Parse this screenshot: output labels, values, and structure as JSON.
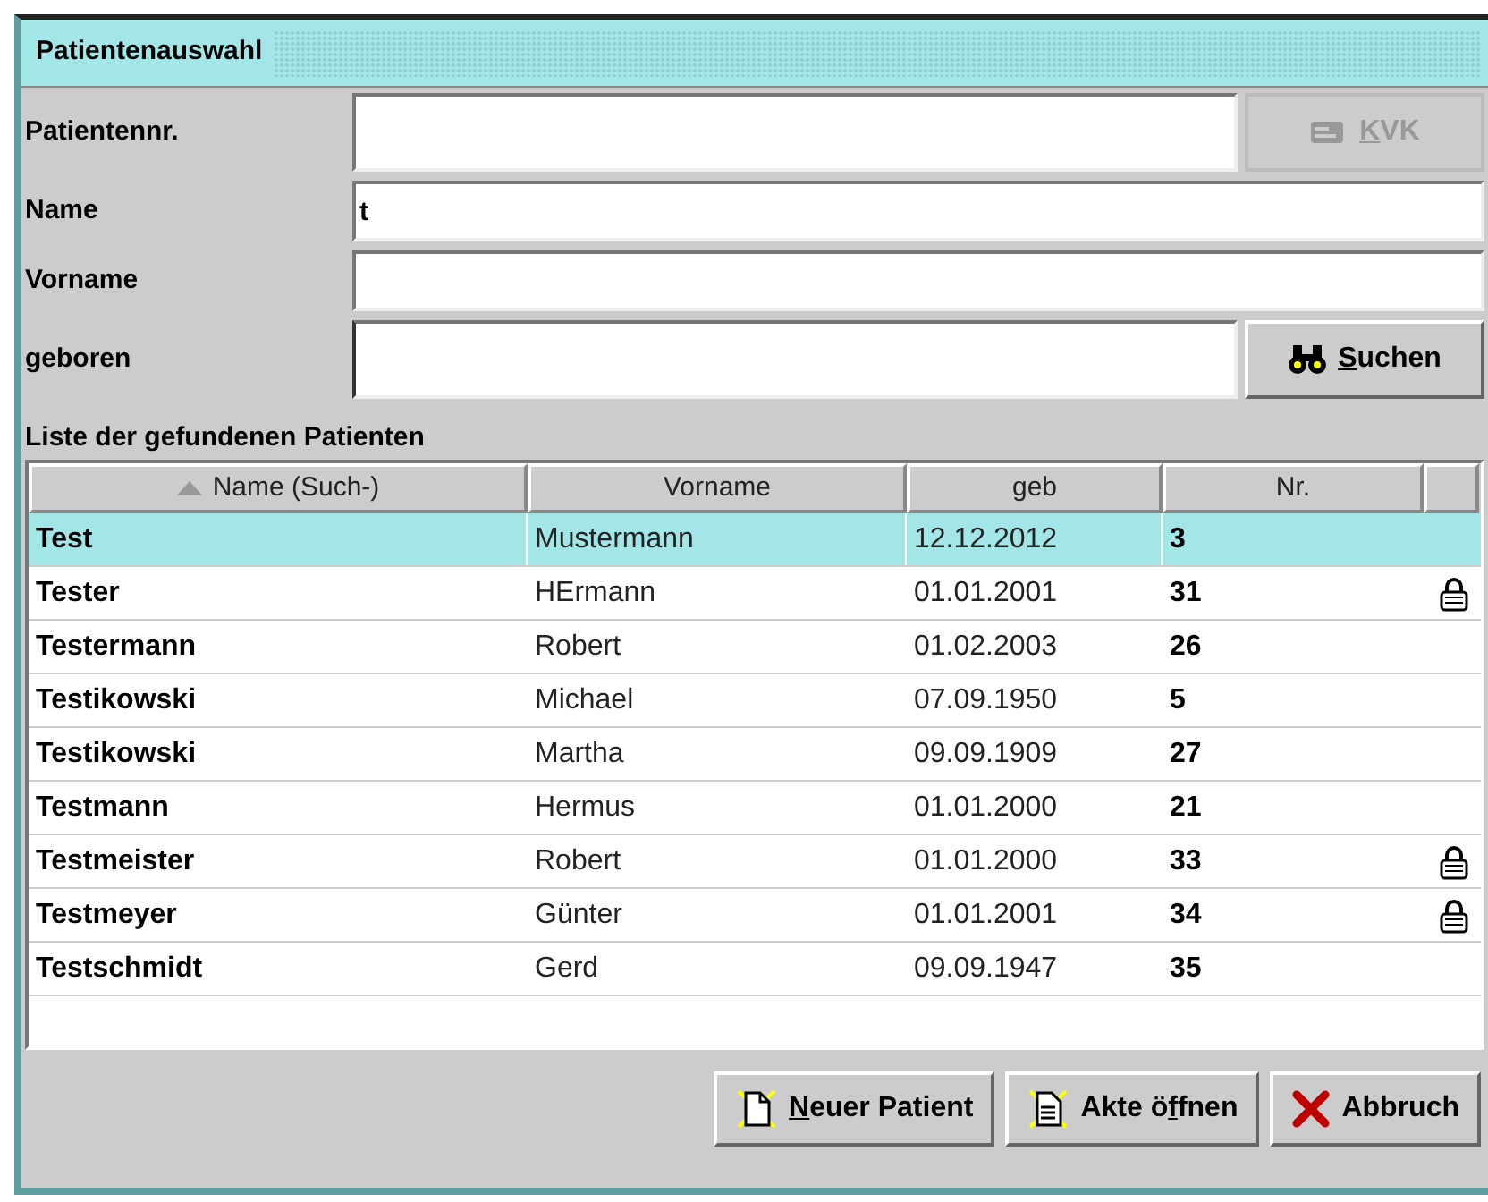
{
  "window": {
    "title": "Patientenauswahl"
  },
  "fields": [
    {
      "label": "Patientennr.",
      "button": {
        "label": "KVK",
        "disabled": true
      }
    },
    {
      "label": "Name",
      "value": "t"
    },
    {
      "label": "Vorname"
    },
    {
      "label": "geboren",
      "focused": true,
      "button": {
        "label": "Suchen",
        "disabled": false
      }
    }
  ],
  "list_label": "Liste der gefundenen Patienten",
  "table": {
    "columns": [
      {
        "label": "Name (Such-)",
        "sorted": true
      },
      {
        "label": "Vorname",
        "sorted": false
      },
      {
        "label": "geb",
        "sorted": false
      },
      {
        "label": "Nr.",
        "sorted": false
      },
      {
        "sorted": false
      }
    ],
    "rows": [
      {
        "name": "Test",
        "vorname": "Mustermann",
        "geb": "12.12.2012",
        "nr": "3",
        "locked": false,
        "selected": true
      },
      {
        "name": "Tester",
        "vorname": "HErmann",
        "geb": "01.01.2001",
        "nr": "31",
        "locked": true,
        "selected": false
      },
      {
        "name": "Testermann",
        "vorname": "Robert",
        "geb": "01.02.2003",
        "nr": "26",
        "locked": false,
        "selected": false
      },
      {
        "name": "Testikowski",
        "vorname": "Michael",
        "geb": "07.09.1950",
        "nr": "5",
        "locked": false,
        "selected": false
      },
      {
        "name": "Testikowski",
        "vorname": "Martha",
        "geb": "09.09.1909",
        "nr": "27",
        "locked": false,
        "selected": false
      },
      {
        "name": "Testmann",
        "vorname": "Hermus",
        "geb": "01.01.2000",
        "nr": "21",
        "locked": false,
        "selected": false
      },
      {
        "name": "Testmeister",
        "vorname": "Robert",
        "geb": "01.01.2000",
        "nr": "33",
        "locked": true,
        "selected": false
      },
      {
        "name": "Testmeyer",
        "vorname": "Günter",
        "geb": "01.01.2001",
        "nr": "34",
        "locked": true,
        "selected": false
      },
      {
        "name": "Testschmidt",
        "vorname": "Gerd",
        "geb": "09.09.1947",
        "nr": "35",
        "locked": false,
        "selected": false
      }
    ]
  },
  "buttons": [
    {
      "label": "Neuer Patient"
    },
    {
      "label": "Akte öffnen"
    },
    {
      "label": "Abbruch"
    }
  ]
}
